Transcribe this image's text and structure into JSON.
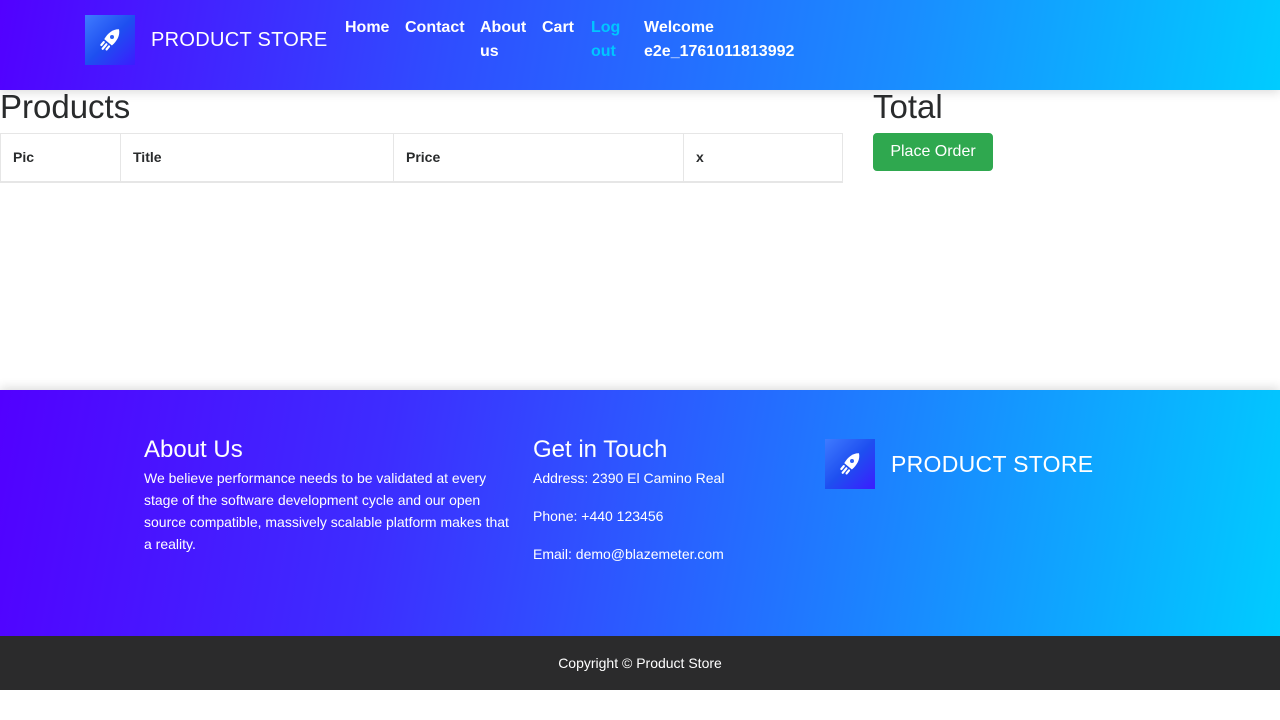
{
  "navbar": {
    "brand": "PRODUCT STORE",
    "links": {
      "home": "Home",
      "contact": "Contact",
      "about": "About us",
      "cart": "Cart",
      "logout": "Log out"
    },
    "welcome": "Welcome e2e_1761011813992"
  },
  "cart": {
    "products_title": "Products",
    "total_title": "Total",
    "columns": [
      "Pic",
      "Title",
      "Price",
      "x"
    ],
    "rows": [],
    "place_order_label": "Place Order"
  },
  "footer": {
    "about": {
      "heading": "About Us",
      "text": "We believe performance needs to be validated at every stage of the software development cycle and our open source compatible, massively scalable platform makes that a reality."
    },
    "contact": {
      "heading": "Get in Touch",
      "address": "Address: 2390 El Camino Real",
      "phone": "Phone: +440 123456",
      "email": "Email: demo@blazemeter.com"
    },
    "brand": "PRODUCT STORE",
    "copyright": "Copyright © Product Store"
  },
  "colors": {
    "gradient_start": "#5200ff",
    "gradient_end": "#00ccff",
    "logout_link": "#00c6ff",
    "place_order_button": "#2fa84f",
    "copyright_bg": "#2b2b2c"
  },
  "icons": {
    "brand_logo": "rocket-icon"
  }
}
